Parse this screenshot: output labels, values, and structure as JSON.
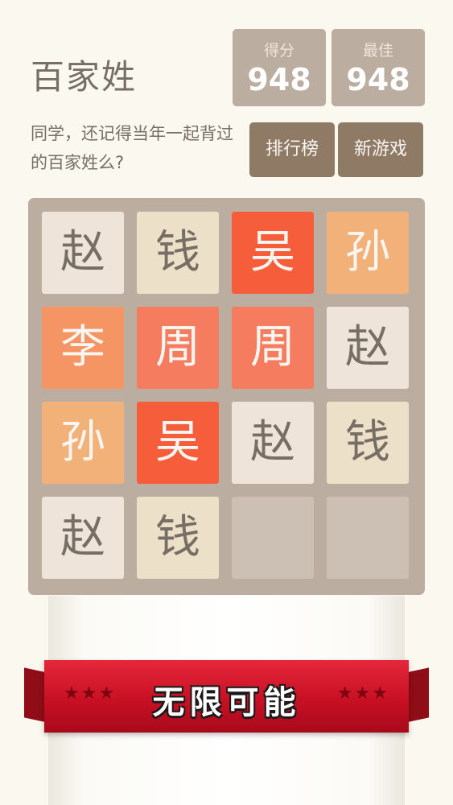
{
  "app": {
    "title": "百家姓",
    "subtitle": "同学，还记得当年一起背过的百家姓么?"
  },
  "score": {
    "label": "得分",
    "value": "948"
  },
  "best": {
    "label": "最佳",
    "value": "948"
  },
  "buttons": {
    "leaderboard": "排行榜",
    "new_game": "新游戏"
  },
  "board": {
    "rows": [
      [
        {
          "text": "赵",
          "level": 1
        },
        {
          "text": "钱",
          "level": 2
        },
        {
          "text": "吴",
          "level": 6
        },
        {
          "text": "孙",
          "level": 3
        }
      ],
      [
        {
          "text": "李",
          "level": 4
        },
        {
          "text": "周",
          "level": 5
        },
        {
          "text": "周",
          "level": 5
        },
        {
          "text": "赵",
          "level": 1
        }
      ],
      [
        {
          "text": "孙",
          "level": 3
        },
        {
          "text": "吴",
          "level": 6
        },
        {
          "text": "赵",
          "level": 1
        },
        {
          "text": "钱",
          "level": 2
        }
      ],
      [
        {
          "text": "赵",
          "level": 1
        },
        {
          "text": "钱",
          "level": 2
        },
        null,
        null
      ]
    ]
  },
  "banner": {
    "text": "无限可能",
    "stars_left": "★★★",
    "stars_right": "★★★"
  }
}
